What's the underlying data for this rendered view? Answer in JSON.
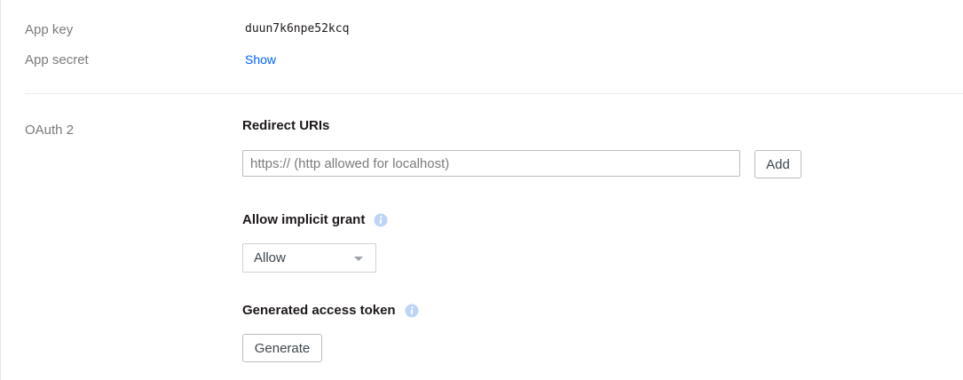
{
  "credentials": {
    "app_key_label": "App key",
    "app_key_value": "duun7k6npe52kcq",
    "app_secret_label": "App secret",
    "app_secret_action": "Show"
  },
  "oauth": {
    "section_label": "OAuth 2",
    "redirect_uris": {
      "heading": "Redirect URIs",
      "input_value": "",
      "input_placeholder": "https:// (http allowed for localhost)",
      "add_button": "Add"
    },
    "implicit_grant": {
      "heading": "Allow implicit grant",
      "info_icon": "info-icon",
      "selected_option": "Allow"
    },
    "access_token": {
      "heading": "Generated access token",
      "info_icon": "info-icon",
      "generate_button": "Generate"
    }
  },
  "colors": {
    "link": "#0061fe",
    "info_icon": "#bcd4f6",
    "label": "#7b7b7b"
  }
}
